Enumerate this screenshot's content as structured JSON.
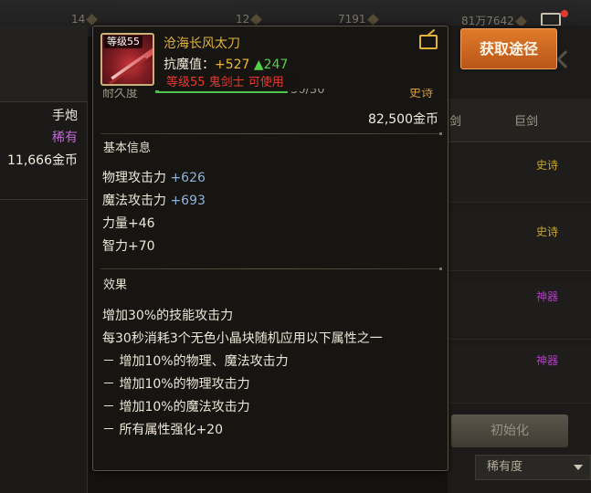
{
  "topbar": {
    "stat1": "14",
    "stat2": "12",
    "stat3": "7191",
    "stat4": "81万7642"
  },
  "left_panel": {
    "type": "手炮",
    "rarity": "稀有",
    "price": "11,666金币"
  },
  "right_panel": {
    "tab_right": "巨剑",
    "tab_left_partial": "剑",
    "rows": [
      {
        "tag": "史诗",
        "tag_color": "#c9a62a"
      },
      {
        "tag": "史诗",
        "tag_color": "#c9a62a"
      },
      {
        "tag": "神器",
        "tag_color": "#b53bc7"
      },
      {
        "tag": "神器",
        "tag_color": "#b53bc7"
      }
    ],
    "reset_label": "初始化",
    "rarity_select": "稀有度"
  },
  "obtain_button": "获取途径",
  "tooltip": {
    "level_badge": "等级55",
    "item_name": "沧海长风太刀",
    "resist_label": "抗魔值：",
    "resist_value": "+527",
    "resist_delta": "▲247",
    "requirement": "等级55 鬼剑士 可使用",
    "durability_label": "耐久度",
    "durability_value": "30/30",
    "durability_fraction": 1.0,
    "grade": "史诗",
    "price": "82,500金币",
    "basic_info_title": "基本信息",
    "stats": [
      {
        "label": "物理攻击力 ",
        "value": "+626"
      },
      {
        "label": "魔法攻击力 ",
        "value": "+693"
      },
      {
        "label": "力量+46",
        "value": ""
      },
      {
        "label": "智力+70",
        "value": ""
      }
    ],
    "effect_title": "效果",
    "effects": [
      "增加30%的技能攻击力",
      "每30秒消耗3个无色小晶块随机应用以下属性之一",
      "－ 增加10%的物理、魔法攻击力",
      "－ 增加10%的物理攻击力",
      "－ 增加10%的魔法攻击力",
      "－ 所有属性强化+20"
    ],
    "colors": {
      "name": "#e0b23a",
      "requirement": "#e8382e",
      "stat_value": "#8fb3d9",
      "delta": "#56d04a"
    }
  }
}
